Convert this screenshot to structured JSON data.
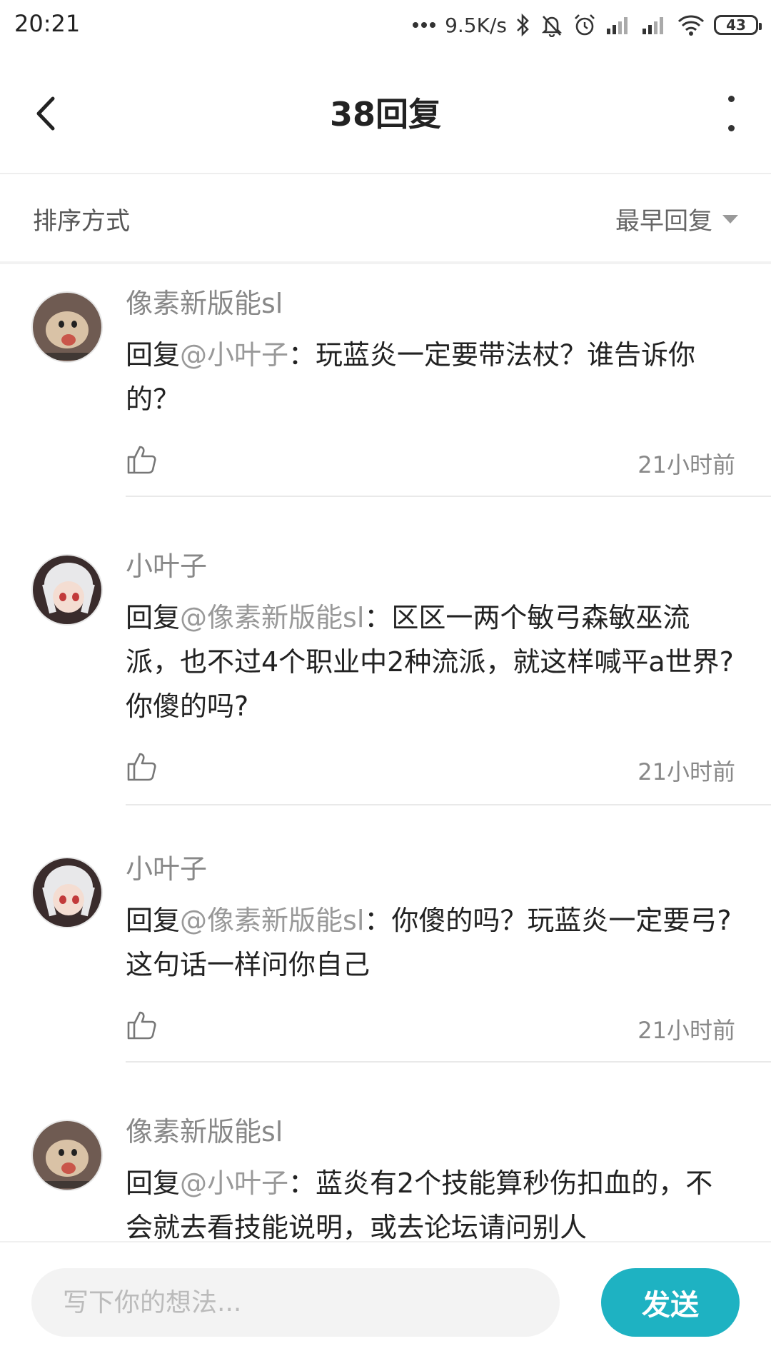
{
  "status_bar": {
    "time": "20:21",
    "network_speed": "9.5K/s",
    "battery": "43",
    "icons": [
      "dots-icon",
      "bluetooth-icon",
      "mute-bell-icon",
      "alarm-icon",
      "signal-icon",
      "signal-icon",
      "wifi-icon",
      "battery-icon"
    ]
  },
  "header": {
    "title": "38回复"
  },
  "sort": {
    "label": "排序方式",
    "selected": "最早回复"
  },
  "comments": [
    {
      "name": "像素新版能sl",
      "prefix": "回复",
      "mention": "@小叶子",
      "text": "：玩蓝炎一定要带法杖？谁告诉你的？",
      "time": "21小时前",
      "avatar": "hamster-avatar"
    },
    {
      "name": "小叶子",
      "prefix": "回复",
      "mention": "@像素新版能sl",
      "text": "：区区一两个敏弓森敏巫流派，也不过4个职业中2种流派，就这样喊平a世界?你傻的吗?",
      "time": "21小时前",
      "avatar": "anime-girl-avatar"
    },
    {
      "name": "小叶子",
      "prefix": "回复",
      "mention": "@像素新版能sl",
      "text": "：你傻的吗？玩蓝炎一定要弓?这句话一样问你自己",
      "time": "21小时前",
      "avatar": "anime-girl-avatar"
    },
    {
      "name": "像素新版能sl",
      "prefix": "回复",
      "mention": "@小叶子",
      "text": "：蓝炎有2个技能算秒伤扣血的，不会就去看技能说明，或去论坛请问别人",
      "time": "",
      "avatar": "hamster-avatar"
    }
  ],
  "composer": {
    "placeholder": "写下你的想法...",
    "send_label": "发送"
  },
  "colors": {
    "accent": "#1eb2c2",
    "mention": "#999999",
    "meta_text": "#888888"
  }
}
